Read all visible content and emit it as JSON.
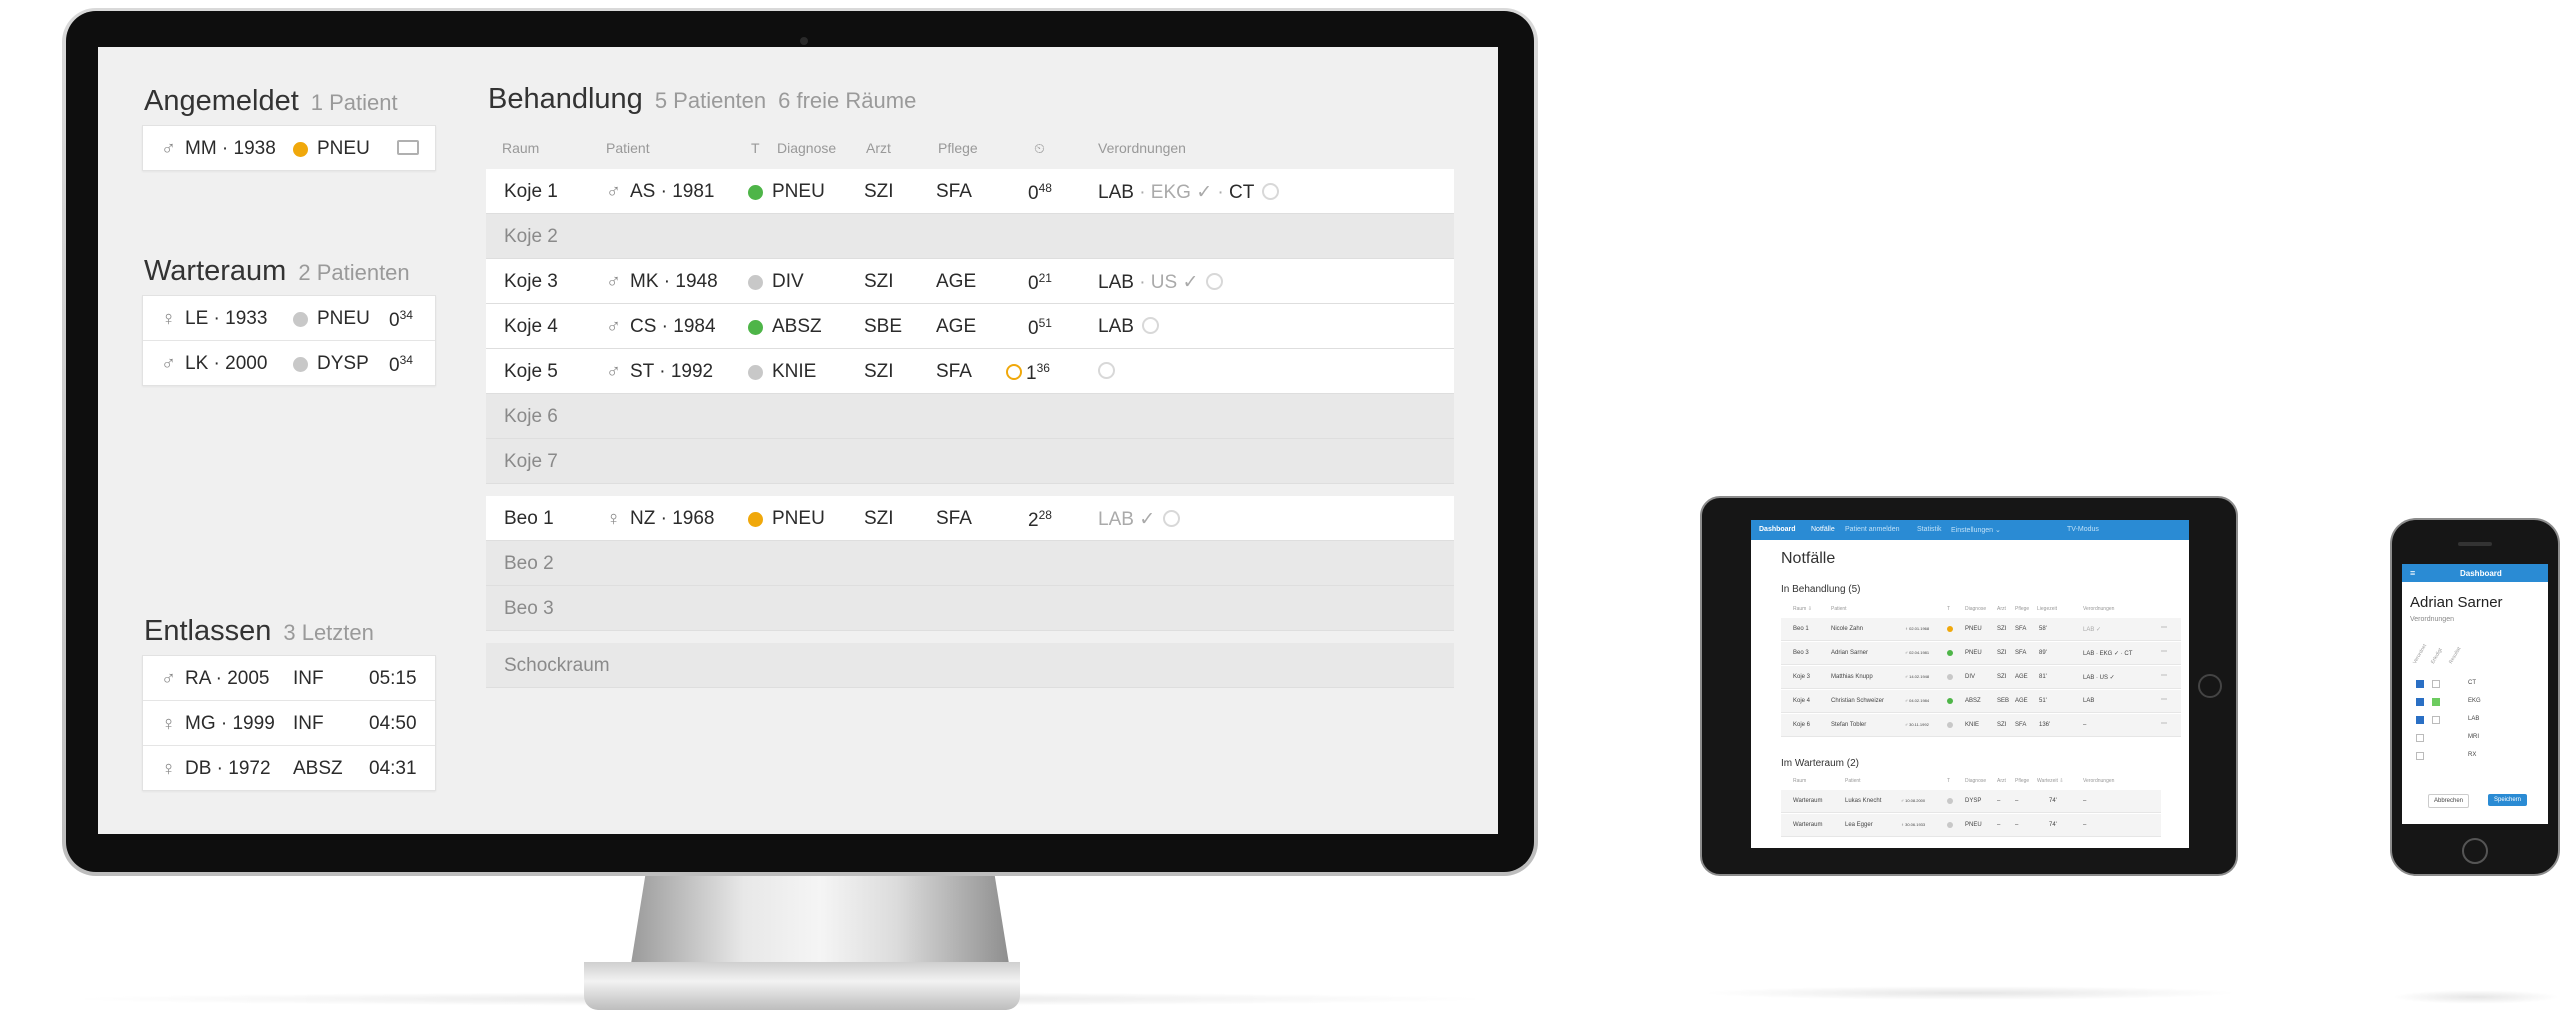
{
  "desktop": {
    "angemeldet": {
      "title": "Angemeldet",
      "count": "1 Patient",
      "rows": [
        {
          "sex": "♂",
          "patient": "MM · 1938",
          "diagnosis": "PNEU",
          "status_color": "#f0a80b"
        }
      ]
    },
    "warteraum": {
      "title": "Warteraum",
      "count": "2 Patienten",
      "rows": [
        {
          "sex": "♀",
          "patient": "LE · 1933",
          "diagnosis": "PNEU",
          "time_main": "0",
          "time_sup": "34"
        },
        {
          "sex": "♂",
          "patient": "LK · 2000",
          "diagnosis": "DYSP",
          "time_main": "0",
          "time_sup": "34"
        }
      ]
    },
    "entlassen": {
      "title": "Entlassen",
      "count": "3 Letzten",
      "rows": [
        {
          "sex": "♂",
          "patient": "RA · 2005",
          "diagnosis": "INF",
          "time": "05:15"
        },
        {
          "sex": "♀",
          "patient": "MG · 1999",
          "diagnosis": "INF",
          "time": "04:50"
        },
        {
          "sex": "♀",
          "patient": "DB · 1972",
          "diagnosis": "ABSZ",
          "time": "04:31"
        }
      ]
    },
    "behandlung": {
      "title": "Behandlung",
      "count": "5 Patienten",
      "free": "6 freie Räume",
      "headers": {
        "raum": "Raum",
        "patient": "Patient",
        "t": "T",
        "diagnose": "Diagnose",
        "arzt": "Arzt",
        "pflege": "Pflege",
        "dauer": "⏲",
        "verordnungen": "Verordnungen"
      },
      "rows": [
        {
          "raum": "Koje 1",
          "sex": "♂",
          "patient": "AS · 1981",
          "diagnosis": "PNEU",
          "arzt": "SZI",
          "pflege": "SFA",
          "time_main": "0",
          "time_sup": "48",
          "orders_a": "LAB",
          "orders_b": " · EKG ✓ · ",
          "orders_c": "CT"
        },
        {
          "raum": "Koje 2"
        },
        {
          "raum": "Koje 3",
          "sex": "♂",
          "patient": "MK · 1948",
          "diagnosis": "DIV",
          "arzt": "SZI",
          "pflege": "AGE",
          "time_main": "0",
          "time_sup": "21",
          "orders_a": "LAB",
          "orders_b": " · US ✓",
          "orders_c": ""
        },
        {
          "raum": "Koje 4",
          "sex": "♂",
          "patient": "CS · 1984",
          "diagnosis": "ABSZ",
          "arzt": "SBE",
          "pflege": "AGE",
          "time_main": "0",
          "time_sup": "51",
          "orders_a": "LAB",
          "orders_b": "",
          "orders_c": ""
        },
        {
          "raum": "Koje 5",
          "sex": "♂",
          "patient": "ST · 1992",
          "diagnosis": "KNIE",
          "arzt": "SZI",
          "pflege": "SFA",
          "time_main": "1",
          "time_sup": "36",
          "orders_a": "",
          "orders_b": "",
          "orders_c": ""
        },
        {
          "raum": "Koje 6"
        },
        {
          "raum": "Koje 7"
        },
        {
          "raum": "Beo 1",
          "sex": "♀",
          "patient": "NZ · 1968",
          "diagnosis": "PNEU",
          "arzt": "SZI",
          "pflege": "SFA",
          "time_main": "2",
          "time_sup": "28",
          "orders_a": "",
          "orders_b": "LAB ✓",
          "orders_c": ""
        },
        {
          "raum": "Beo 2"
        },
        {
          "raum": "Beo 3"
        },
        {
          "raum": "Schockraum"
        }
      ]
    }
  },
  "tablet": {
    "nav": {
      "brand": "Dashboard",
      "items": [
        "Notfälle",
        "Patient anmelden",
        "Statistik",
        "Einstellungen ⌄",
        "TV-Modus"
      ]
    },
    "title": "Notfälle",
    "section1": "In Behandlung (5)",
    "headers1": [
      "Raum ⇩",
      "Patient",
      "T",
      "Diagnose",
      "Arzt",
      "Pflege",
      "Liegezeit",
      "Verordnungen"
    ],
    "rows1": [
      {
        "raum": "Beo 1",
        "name": "Nicole Zahn",
        "dob": "♀ 02.01.1968",
        "diag": "PNEU",
        "arzt": "SZI",
        "pflege": "SFA",
        "time": "58'",
        "orders": "LAB ✓"
      },
      {
        "raum": "Beo 3",
        "name": "Adrian Sarner",
        "dob": "♂ 02.04.1981",
        "diag": "PNEU",
        "arzt": "SZI",
        "pflege": "SFA",
        "time": "89'",
        "orders": "LAB · EKG ✓ · CT"
      },
      {
        "raum": "Koje 3",
        "name": "Matthias Knupp",
        "dob": "♂ 14.02.1948",
        "diag": "DIV",
        "arzt": "SZI",
        "pflege": "AGE",
        "time": "81'",
        "orders": "LAB · US ✓"
      },
      {
        "raum": "Koje 4",
        "name": "Christian Schweizer",
        "dob": "♂ 04.02.1984",
        "diag": "ABSZ",
        "arzt": "SEB",
        "pflege": "AGE",
        "time": "51'",
        "orders": "LAB"
      },
      {
        "raum": "Koje 6",
        "name": "Stefan Tobler",
        "dob": "♂ 30.11.1992",
        "diag": "KNIE",
        "arzt": "SZI",
        "pflege": "SFA",
        "time": "136'",
        "orders": "–"
      }
    ],
    "section2": "Im Warteraum (2)",
    "headers2": [
      "Raum",
      "Patient",
      "T",
      "Diagnose",
      "Arzt",
      "Pflege",
      "Wartezeit ⇩",
      "Verordnungen"
    ],
    "rows2": [
      {
        "raum": "Warteraum",
        "name": "Lukas Knecht",
        "dob": "♂ 10.08.2000",
        "diag": "DYSP",
        "arzt": "–",
        "pflege": "–",
        "time": "74'",
        "orders": "–"
      },
      {
        "raum": "Warteraum",
        "name": "Lea Egger",
        "dob": "♀ 30.06.1933",
        "diag": "PNEU",
        "arzt": "–",
        "pflege": "–",
        "time": "74'",
        "orders": "–"
      }
    ],
    "row_button": "⋯"
  },
  "phone": {
    "brand": "Dashboard",
    "menu_icon": "≡",
    "title": "Adrian Sarner",
    "subtitle": "Verordnungen",
    "col_headers": [
      "Verordnet",
      "Erledigt",
      "Resultat"
    ],
    "items": [
      "CT",
      "EKG",
      "LAB",
      "MRI",
      "RX"
    ],
    "cancel": "Abbrechen",
    "save": "Speichern"
  }
}
